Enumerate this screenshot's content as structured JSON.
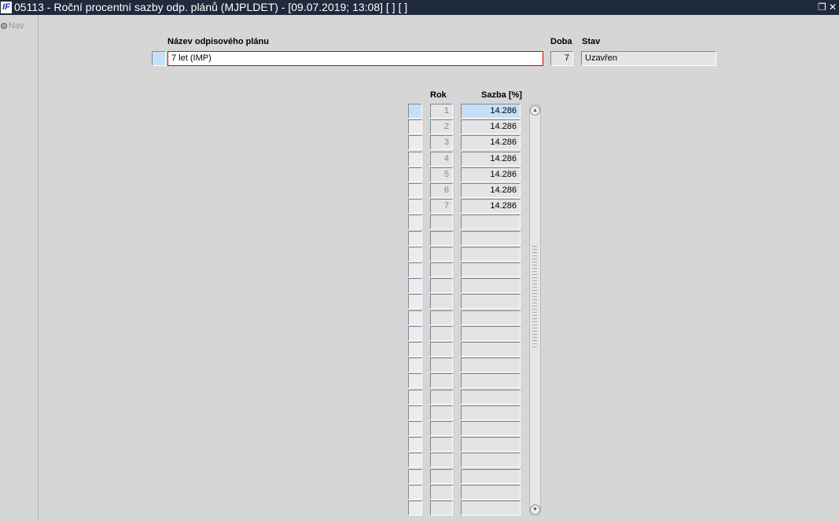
{
  "title": "05113 - Roční procentní sazby odp. plánů (MJPLDET) - [09.07.2019; 13:08]  [ ]  [ ]",
  "logo": "IF",
  "nav": "Nav",
  "header": {
    "name_label": "Název odpisového plánu",
    "name_value": "7 let (IMP)",
    "doba_label": "Doba",
    "doba_value": "7",
    "stav_label": "Stav",
    "stav_value": "Uzavřen"
  },
  "table": {
    "col_rok": "Rok",
    "col_sazba": "Sazba [%]",
    "rows": [
      {
        "rok": "1",
        "sazba": "14.286"
      },
      {
        "rok": "2",
        "sazba": "14.286"
      },
      {
        "rok": "3",
        "sazba": "14.286"
      },
      {
        "rok": "4",
        "sazba": "14.286"
      },
      {
        "rok": "5",
        "sazba": "14.286"
      },
      {
        "rok": "6",
        "sazba": "14.286"
      },
      {
        "rok": "7",
        "sazba": "14.286"
      }
    ],
    "total_rows": 26
  }
}
